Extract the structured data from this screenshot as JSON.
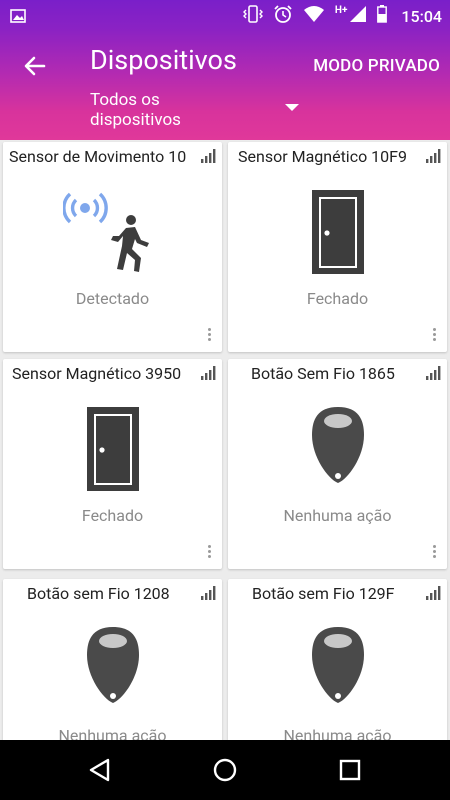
{
  "status_bar": {
    "time": "15:04",
    "network": "H+",
    "icons": [
      "image-icon",
      "vibrate-icon",
      "alarm-icon",
      "wifi-icon",
      "cell-signal-icon",
      "battery-icon"
    ]
  },
  "header": {
    "title": "Dispositivos",
    "action": "MODO PRIVADO",
    "filter": "Todos os dispositivos"
  },
  "devices": [
    {
      "name": "Sensor de Movimento 10",
      "status": "Detectado",
      "icon": "motion-sensor-icon"
    },
    {
      "name": "Sensor Magnético 10F9",
      "status": "Fechado",
      "icon": "door-icon"
    },
    {
      "name": "Sensor Magnético 3950",
      "status": "Fechado",
      "icon": "door-icon"
    },
    {
      "name": "Botão Sem Fio 1865",
      "status": "Nenhuma ação",
      "icon": "key-fob-icon"
    },
    {
      "name": "Botão sem Fio 1208",
      "status": "Nenhuma ação",
      "icon": "key-fob-icon"
    },
    {
      "name": "Botão sem Fio 129F",
      "status": "Nenhuma ação",
      "icon": "key-fob-icon"
    }
  ],
  "colors": {
    "header_gradient_top": "#7a1fc9",
    "header_gradient_bottom": "#e0389a",
    "icon_gray": "#3d3d3d",
    "motion_waves": "#7fa7ec"
  }
}
